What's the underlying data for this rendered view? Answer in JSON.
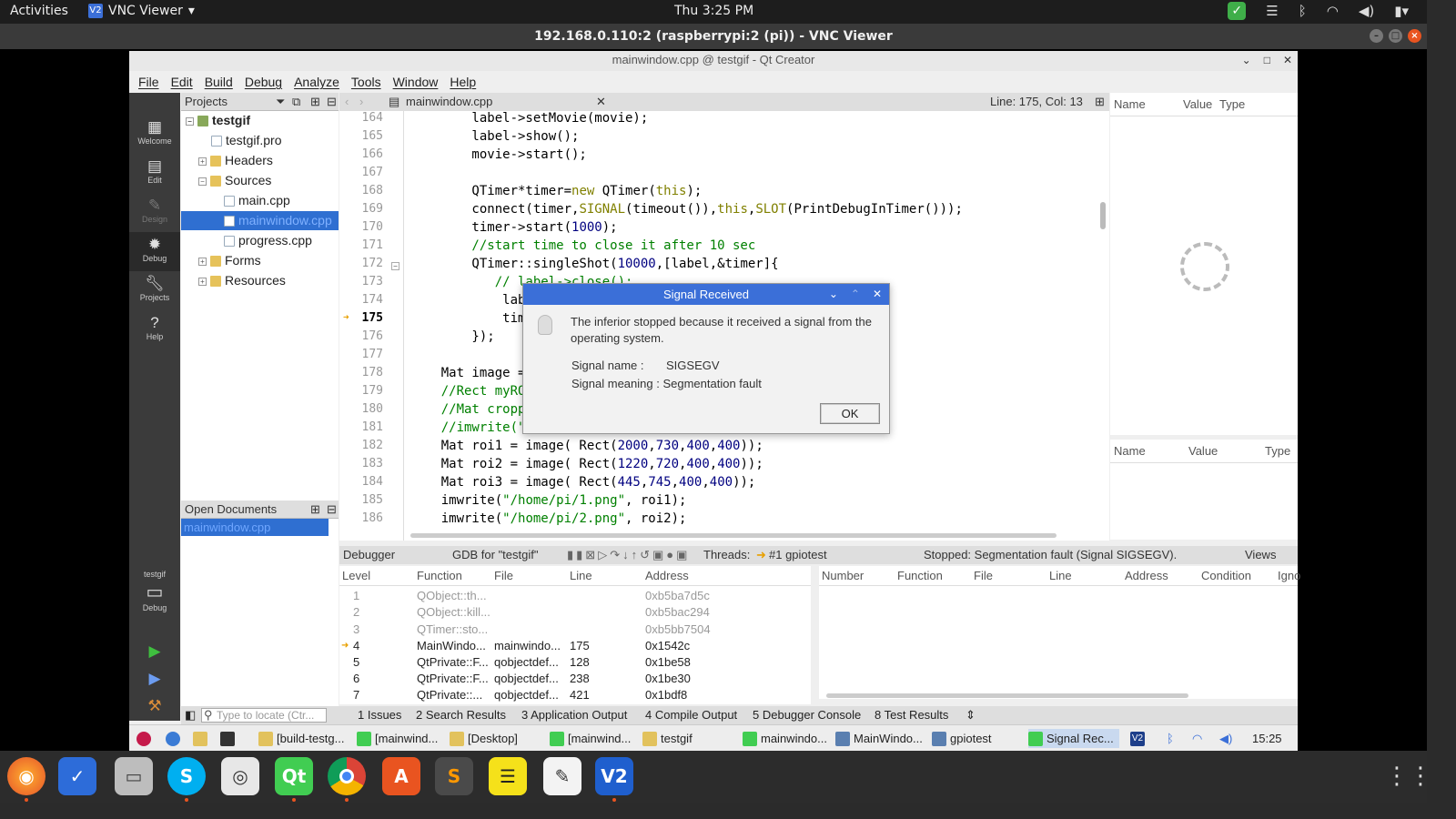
{
  "topbar": {
    "activities": "Activities",
    "app": "VNC Viewer",
    "clock": "Thu  3:25 PM"
  },
  "vnc": {
    "title": "192.168.0.110:2 (raspberrypi:2 (pi)) - VNC Viewer"
  },
  "qt": {
    "title": "mainwindow.cpp @ testgif - Qt Creator",
    "menu": [
      "File",
      "Edit",
      "Build",
      "Debug",
      "Analyze",
      "Tools",
      "Window",
      "Help"
    ],
    "modes": [
      "Welcome",
      "Edit",
      "Design",
      "Debug",
      "Projects",
      "Help"
    ],
    "kit": {
      "project": "testgif",
      "mode": "Debug"
    }
  },
  "projects": {
    "header": "Projects",
    "tree": [
      {
        "label": "testgif",
        "type": "project"
      },
      {
        "label": "testgif.pro",
        "type": "pro"
      },
      {
        "label": "Headers",
        "type": "folder"
      },
      {
        "label": "Sources",
        "type": "folder"
      },
      {
        "label": "main.cpp",
        "type": "file"
      },
      {
        "label": "mainwindow.cpp",
        "type": "file",
        "selected": true
      },
      {
        "label": "progress.cpp",
        "type": "file"
      },
      {
        "label": "Forms",
        "type": "folder"
      },
      {
        "label": "Resources",
        "type": "folder"
      }
    ]
  },
  "opendocs": {
    "header": "Open Documents",
    "items": [
      "mainwindow.cpp"
    ]
  },
  "editor": {
    "filename": "mainwindow.cpp",
    "position": "Line: 175, Col: 13",
    "current_line": 175,
    "lines": [
      {
        "n": "164",
        "code": "        label->setMovie(movie);"
      },
      {
        "n": "165",
        "code": "        label->show();"
      },
      {
        "n": "166",
        "code": "        movie->start();"
      },
      {
        "n": "167",
        "code": ""
      },
      {
        "n": "168",
        "code": "        QTimer*timer=new QTimer(this);"
      },
      {
        "n": "169",
        "code": "        connect(timer,SIGNAL(timeout()),this,SLOT(PrintDebugInTimer()));"
      },
      {
        "n": "170",
        "code": "        timer->start(1000);"
      },
      {
        "n": "171",
        "code": "        //start time to close it after 10 sec"
      },
      {
        "n": "172",
        "code": "        QTimer::singleShot(10000,[label,&timer]{"
      },
      {
        "n": "173",
        "code": "           // label->close();"
      },
      {
        "n": "174",
        "code": "            label->close();"
      },
      {
        "n": "175",
        "code": "            timer->stop();"
      },
      {
        "n": "176",
        "code": "        });"
      },
      {
        "n": "177",
        "code": ""
      },
      {
        "n": "178",
        "code": "    Mat image = imread(\"/home/pi/1.png\");"
      },
      {
        "n": "179",
        "code": "    //Rect myROI(10, 10, 100, 100);"
      },
      {
        "n": "180",
        "code": "    //Mat croppedImage = image(myROI);"
      },
      {
        "n": "181",
        "code": "    //imwrite(\"/home/pi/1.png\", crop);"
      },
      {
        "n": "182",
        "code": "    Mat roi1 = image( Rect(2000,730,400,400));"
      },
      {
        "n": "183",
        "code": "    Mat roi2 = image( Rect(1220,720,400,400));"
      },
      {
        "n": "184",
        "code": "    Mat roi3 = image( Rect(445,745,400,400));"
      },
      {
        "n": "185",
        "code": "    imwrite(\"/home/pi/1.png\", roi1);"
      },
      {
        "n": "186",
        "code": "    imwrite(\"/home/pi/2.png\", roi2);"
      }
    ]
  },
  "locals": {
    "columns": [
      "Name",
      "Value",
      "Type"
    ]
  },
  "watch": {
    "columns": [
      "Name",
      "Value",
      "Type"
    ]
  },
  "debugbar": {
    "debugger": "Debugger",
    "gdb": "GDB for \"testgif\"",
    "threads_label": "Threads:",
    "thread": "#1 gpiotest",
    "status": "Stopped: Segmentation fault (Signal SIGSEGV).",
    "views": "Views"
  },
  "stack": {
    "columns": [
      "Level",
      "Function",
      "File",
      "Line",
      "Address"
    ],
    "rows": [
      {
        "level": "1",
        "function": "QObject::th...",
        "file": "",
        "line": "",
        "address": "0xb5ba7d5c",
        "dim": true
      },
      {
        "level": "2",
        "function": "QObject::kill...",
        "file": "",
        "line": "",
        "address": "0xb5bac294",
        "dim": true
      },
      {
        "level": "3",
        "function": "QTimer::sto...",
        "file": "",
        "line": "",
        "address": "0xb5bb7504",
        "dim": true
      },
      {
        "level": "4",
        "function": "MainWindo...",
        "file": "mainwindo...",
        "line": "175",
        "address": "0x1542c",
        "dim": false,
        "current": true
      },
      {
        "level": "5",
        "function": "QtPrivate::F...",
        "file": "qobjectdef...",
        "line": "128",
        "address": "0x1be58",
        "dim": false
      },
      {
        "level": "6",
        "function": "QtPrivate::F...",
        "file": "qobjectdef...",
        "line": "238",
        "address": "0x1be30",
        "dim": false
      },
      {
        "level": "7",
        "function": "QtPrivate::...",
        "file": "qobjectdef...",
        "line": "421",
        "address": "0x1bdf8",
        "dim": false
      }
    ]
  },
  "breakpoints": {
    "columns": [
      "Number",
      "Function",
      "File",
      "Line",
      "Address",
      "Condition",
      "Igno"
    ]
  },
  "outbar": {
    "locate_placeholder": "Type to locate (Ctr...",
    "tabs": [
      "1 Issues",
      "2 Search Results",
      "3 Application Output",
      "4 Compile Output",
      "5 Debugger Console",
      "8 Test Results"
    ]
  },
  "dialog": {
    "title": "Signal Received",
    "message": "The inferior stopped because it received a signal from the operating system.",
    "signal_name_label": "Signal name :",
    "signal_name": "SIGSEGV",
    "signal_meaning_label": "Signal meaning :",
    "signal_meaning": "Segmentation fault",
    "ok": "OK"
  },
  "rpanel": {
    "tasks": [
      "[build-testg...",
      "[mainwind...",
      "[Desktop]",
      "[mainwind...",
      "testgif",
      "mainwindo...",
      "MainWindo...",
      "gpiotest",
      "Signal Rec..."
    ],
    "time": "15:25"
  },
  "dock": {
    "apps": [
      "firefox",
      "todo",
      "files",
      "skype",
      "scanner",
      "qt-creator",
      "chrome",
      "software",
      "sublime",
      "notes",
      "text-editor",
      "vnc-viewer"
    ]
  }
}
